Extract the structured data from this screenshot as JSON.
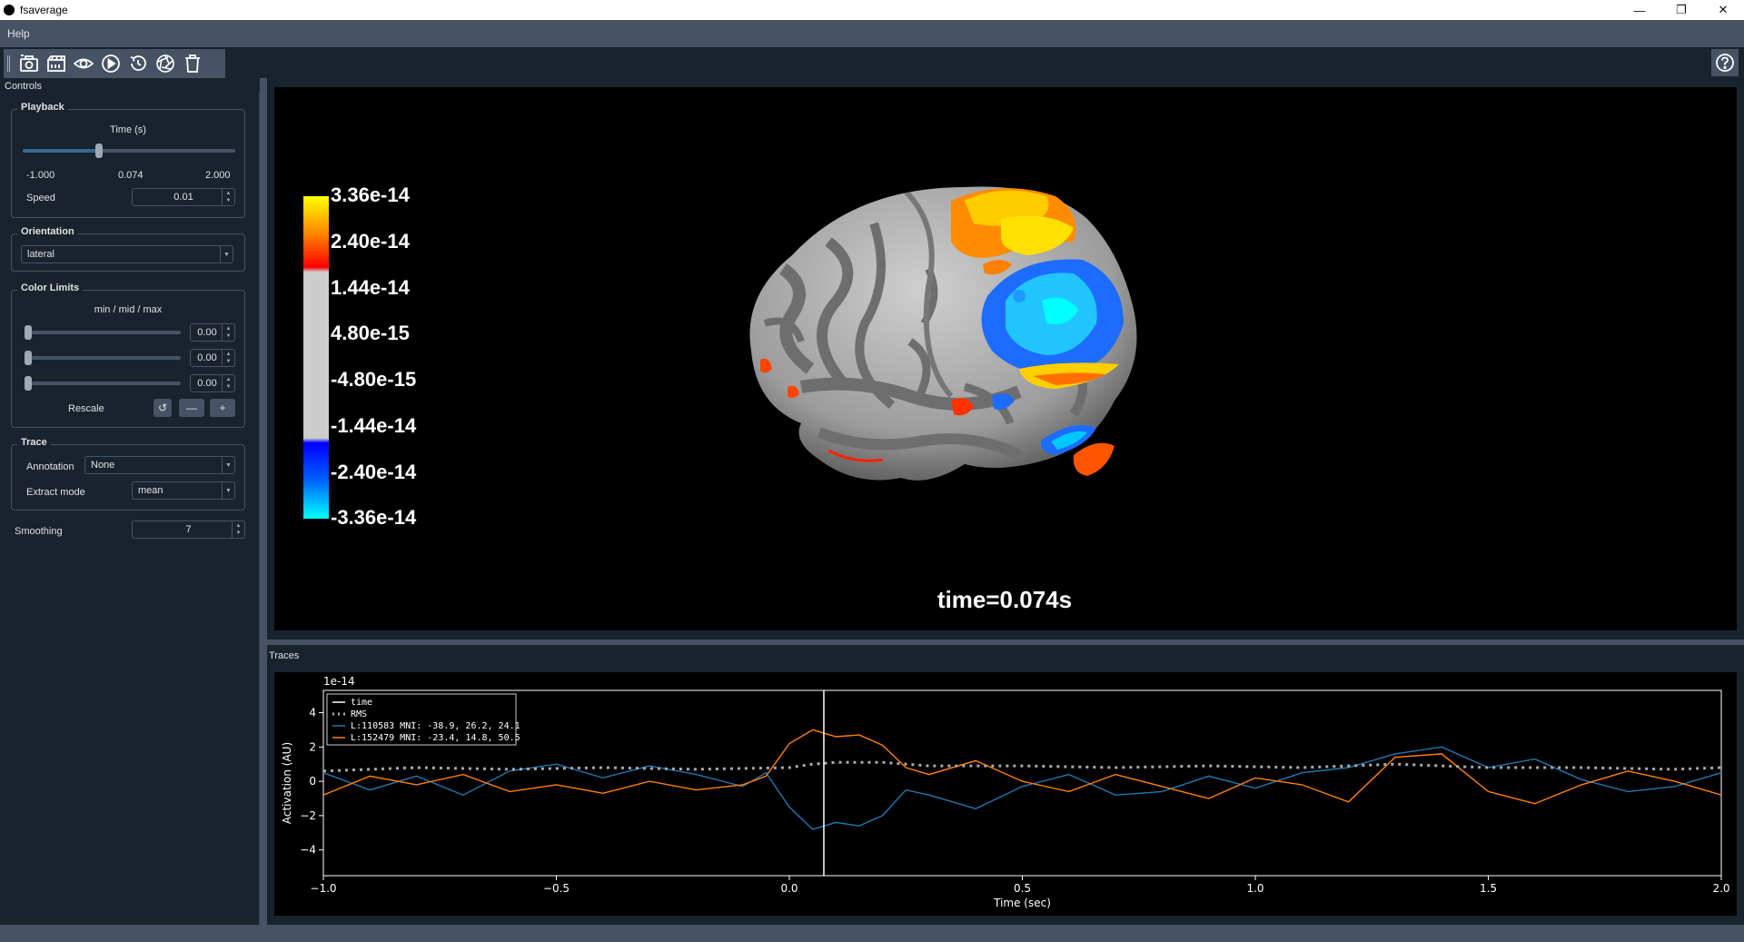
{
  "window": {
    "title": "fsaverage",
    "minimize": "—",
    "restore": "❐",
    "close": "✕"
  },
  "menubar": {
    "items": [
      "Help"
    ]
  },
  "toolbar": {
    "buttons": [
      "screenshot-icon",
      "movie-icon",
      "visibility-icon",
      "play-icon",
      "reset-icon",
      "camera-shutter-icon",
      "trash-icon"
    ],
    "help": "help-icon"
  },
  "controls": {
    "title": "Controls",
    "playback": {
      "title": "Playback",
      "time_label": "Time (s)",
      "time_min": "-1.000",
      "time_value": "0.074",
      "time_max": "2.000",
      "time_fraction": 0.358,
      "speed_label": "Speed",
      "speed_value": "0.01"
    },
    "orientation": {
      "title": "Orientation",
      "value": "lateral"
    },
    "color_limits": {
      "title": "Color Limits",
      "subtitle": "min / mid / max",
      "values": [
        "0.00",
        "0.00",
        "0.00"
      ],
      "rescale_label": "Rescale",
      "reset_glyph": "↺",
      "minus_glyph": "—",
      "plus_glyph": "+"
    },
    "trace": {
      "title": "Trace",
      "annotation_label": "Annotation",
      "annotation_value": "None",
      "extract_label": "Extract mode",
      "extract_value": "mean"
    },
    "smoothing": {
      "label": "Smoothing",
      "value": "7"
    }
  },
  "viewer": {
    "colorbar_ticks": [
      "3.36e-14",
      "2.40e-14",
      "1.44e-14",
      "4.80e-15",
      "-4.80e-15",
      "-1.44e-14",
      "-2.40e-14",
      "-3.36e-14"
    ],
    "time_text": "time=0.074s"
  },
  "traces": {
    "title": "Traces",
    "chart_data": {
      "type": "line",
      "offset_text": "1e-14",
      "xlabel": "Time (sec)",
      "ylabel": "Activation (AU)",
      "xlim": [
        -1.0,
        2.0
      ],
      "ylim": [
        -5.5,
        5.3
      ],
      "xticks": [
        -1.0,
        -0.5,
        0.0,
        0.5,
        1.0,
        1.5,
        2.0
      ],
      "xtick_labels": [
        "−1.0",
        "−0.5",
        "0.0",
        "0.5",
        "1.0",
        "1.5",
        "2.0"
      ],
      "yticks": [
        4,
        2,
        0,
        -2,
        -4
      ],
      "ytick_labels": [
        "4",
        "2",
        "0",
        "−2",
        "−4"
      ],
      "time_marker": 0.074,
      "legend_placement": "upper-left",
      "series": [
        {
          "name": "time",
          "color": "#ffffff",
          "style": "solid"
        },
        {
          "name": "RMS",
          "color": "#aaaaaa",
          "style": "dotted",
          "x": [
            -1.0,
            -0.8,
            -0.6,
            -0.4,
            -0.2,
            0.0,
            0.05,
            0.1,
            0.2,
            0.3,
            0.5,
            0.7,
            0.9,
            1.1,
            1.3,
            1.5,
            1.7,
            1.9,
            2.0
          ],
          "y": [
            0.6,
            0.8,
            0.7,
            0.8,
            0.7,
            0.8,
            1.0,
            1.1,
            1.1,
            0.9,
            0.9,
            0.8,
            0.9,
            0.8,
            1.0,
            0.8,
            0.8,
            0.7,
            0.8
          ]
        },
        {
          "name": "L:110583 MNI: -38.9,  26.2,  24.1",
          "color": "#1f77b4",
          "style": "solid",
          "x": [
            -1.0,
            -0.9,
            -0.8,
            -0.7,
            -0.6,
            -0.5,
            -0.4,
            -0.3,
            -0.2,
            -0.1,
            -0.05,
            0.0,
            0.05,
            0.1,
            0.15,
            0.2,
            0.25,
            0.3,
            0.4,
            0.5,
            0.6,
            0.7,
            0.8,
            0.9,
            1.0,
            1.1,
            1.2,
            1.3,
            1.4,
            1.5,
            1.6,
            1.7,
            1.8,
            1.9,
            2.0
          ],
          "y": [
            0.5,
            -0.5,
            0.3,
            -0.8,
            0.6,
            1.0,
            0.2,
            0.9,
            0.4,
            -0.3,
            0.5,
            -1.5,
            -2.8,
            -2.4,
            -2.6,
            -2.0,
            -0.5,
            -0.8,
            -1.6,
            -0.3,
            0.4,
            -0.8,
            -0.6,
            0.3,
            -0.4,
            0.5,
            0.8,
            1.6,
            2.0,
            0.8,
            1.3,
            0.1,
            -0.6,
            -0.3,
            0.5
          ]
        },
        {
          "name": "L:152479 MNI: -23.4,  14.8,  50.5",
          "color": "#ff7f0e",
          "style": "solid",
          "x": [
            -1.0,
            -0.9,
            -0.8,
            -0.7,
            -0.6,
            -0.5,
            -0.4,
            -0.3,
            -0.2,
            -0.1,
            -0.05,
            0.0,
            0.05,
            0.1,
            0.15,
            0.2,
            0.25,
            0.3,
            0.4,
            0.5,
            0.6,
            0.7,
            0.8,
            0.9,
            1.0,
            1.1,
            1.2,
            1.3,
            1.4,
            1.5,
            1.6,
            1.7,
            1.8,
            1.9,
            2.0
          ],
          "y": [
            -0.8,
            0.3,
            -0.2,
            0.4,
            -0.6,
            -0.2,
            -0.7,
            0.0,
            -0.5,
            -0.2,
            0.3,
            2.2,
            3.0,
            2.6,
            2.7,
            2.1,
            0.8,
            0.4,
            1.2,
            0.0,
            -0.6,
            0.4,
            -0.3,
            -1.0,
            0.2,
            -0.2,
            -1.2,
            1.4,
            1.6,
            -0.6,
            -1.3,
            -0.2,
            0.6,
            0.0,
            -0.8
          ]
        }
      ]
    }
  }
}
